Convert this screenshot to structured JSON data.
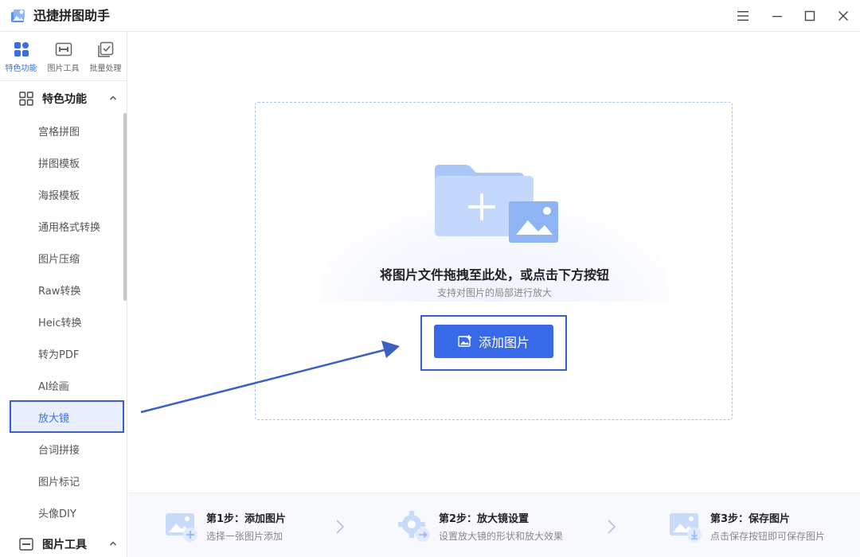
{
  "app": {
    "title": "迅捷拼图助手"
  },
  "window_controls": [
    "menu-icon",
    "minimize-icon",
    "maximize-icon",
    "close-icon"
  ],
  "top_tabs": [
    {
      "label": "特色功能",
      "icon": "grid-icon",
      "active": true
    },
    {
      "label": "图片工具",
      "icon": "image-tool-icon",
      "active": false
    },
    {
      "label": "批量处理",
      "icon": "batch-icon",
      "active": false
    }
  ],
  "sidebar": {
    "groups": [
      {
        "label": "特色功能",
        "icon": "grid-icon",
        "expanded": true
      },
      {
        "label": "图片工具",
        "icon": "image-tool-icon",
        "expanded": true
      }
    ],
    "items": [
      {
        "label": "宫格拼图"
      },
      {
        "label": "拼图模板"
      },
      {
        "label": "海报模板"
      },
      {
        "label": "通用格式转换"
      },
      {
        "label": "图片压缩"
      },
      {
        "label": "Raw转换"
      },
      {
        "label": "Heic转换"
      },
      {
        "label": "转为PDF"
      },
      {
        "label": "AI绘画"
      },
      {
        "label": "放大镜",
        "active": true
      },
      {
        "label": "台词拼接"
      },
      {
        "label": "图片标记"
      },
      {
        "label": "头像DIY"
      }
    ]
  },
  "dropzone": {
    "title": "将图片文件拖拽至此处，或点击下方按钮",
    "subtitle": "支持对图片的局部进行放大",
    "button_label": "添加图片"
  },
  "steps": [
    {
      "title": "第1步：添加图片",
      "desc": "选择一张图片添加"
    },
    {
      "title": "第2步：放大镜设置",
      "desc": "设置放大镜的形状和放大效果"
    },
    {
      "title": "第3步：保存图片",
      "desc": "点击保存按钮即可保存图片"
    }
  ],
  "colors": {
    "accent": "#3769e8",
    "annotation": "#3b5fc4",
    "active_bg": "#e9efff"
  }
}
